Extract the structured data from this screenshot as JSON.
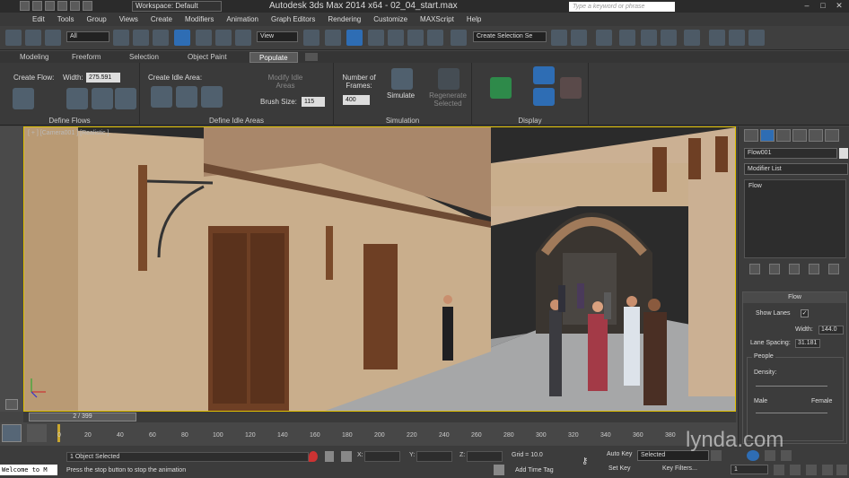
{
  "titlebar": {
    "workspace": "Workspace: Default",
    "app_title": "Autodesk 3ds Max  2014 x64  -  02_04_start.max",
    "search_placeholder": "Type a keyword or phrase"
  },
  "menu": [
    "Edit",
    "Tools",
    "Group",
    "Views",
    "Create",
    "Modifiers",
    "Animation",
    "Graph Editors",
    "Rendering",
    "Customize",
    "MAXScript",
    "Help"
  ],
  "toolbar": {
    "selection_filter": "All",
    "ref_coord": "View",
    "named_sel": "Create Selection Se"
  },
  "ribbon_tabs": [
    "Modeling",
    "Freeform",
    "Selection",
    "Object Paint",
    "Populate"
  ],
  "ribbon": {
    "create_flow": "Create Flow:",
    "width_label": "Width:",
    "width_value": "275.591",
    "define_flows": "Define Flows",
    "create_idle": "Create Idle Area:",
    "modify_idle": "Modify Idle Areas",
    "brush_size_label": "Brush Size:",
    "brush_size_value": "115",
    "define_idle": "Define Idle Areas",
    "frames_label": "Number of Frames:",
    "frames_value": "400",
    "simulate": "Simulate",
    "regenerate": "Regenerate Selected",
    "simulation": "Simulation",
    "display": "Display"
  },
  "viewport": {
    "label": "[ + ] [Camera001 ] [Realistic ]"
  },
  "command_panel": {
    "object_name": "Flow001",
    "modifier_list": "Modifier List",
    "stack_item": "Flow",
    "rollout_title": "Flow",
    "show_lanes": "Show Lanes",
    "width_label": "Width:",
    "width_value": "144.0",
    "lane_spacing_label": "Lane Spacing:",
    "lane_spacing_value": "31.181",
    "people_group": "People",
    "density": "Density:",
    "male": "Male",
    "female": "Female"
  },
  "timeline": {
    "frame_display": "2 / 399",
    "ticks": [
      "0",
      "20",
      "40",
      "60",
      "80",
      "100",
      "120",
      "140",
      "160",
      "180",
      "200",
      "220",
      "240",
      "260",
      "280",
      "300",
      "320",
      "340",
      "360",
      "380"
    ]
  },
  "status": {
    "maxscript": "Welcome to M",
    "selection": "1 Object Selected",
    "prompt": "Press the stop button to stop the animation",
    "x_label": "X:",
    "y_label": "Y:",
    "z_label": "Z:",
    "grid": "Grid = 10.0",
    "add_time_tag": "Add Time Tag",
    "auto_key": "Auto Key",
    "selected": "Selected",
    "set_key": "Set Key",
    "key_filters": "Key Filters...",
    "frame": "1"
  },
  "watermark": "lynda.com"
}
